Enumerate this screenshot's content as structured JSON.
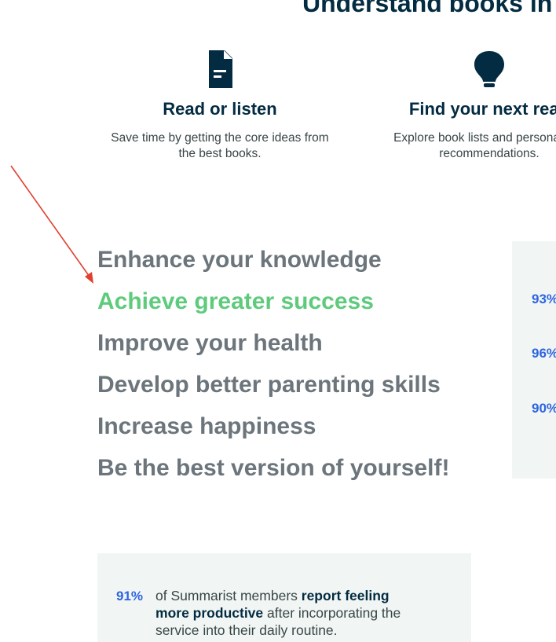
{
  "section_heading": "Understand books in few minutes",
  "features": [
    {
      "icon": "document-icon",
      "title": "Read or listen",
      "description": "Save time by getting the core ideas from the best books."
    },
    {
      "icon": "lightbulb-icon",
      "title": "Find your next read",
      "description": "Explore book lists and personalized recommendations."
    }
  ],
  "headlines": [
    "Enhance your knowledge",
    "Achieve greater success",
    "Improve your health",
    "Develop better parenting skills",
    "Increase happiness",
    "Be the best version of yourself!"
  ],
  "active_headline_index": 1,
  "stats_side": [
    "93%",
    "96%",
    "90%"
  ],
  "bottom_stat": {
    "percent": "91%",
    "text_before": "of Summarist members ",
    "text_bold": "report feeling more productive",
    "text_after": " after incorporating the service into their daily routine."
  },
  "colors": {
    "heading": "#032b41",
    "headline_inactive": "#6b757b",
    "headline_active": "#5ecb7c",
    "stat_blue": "#2d64df",
    "panel_bg": "#f1f6f4",
    "annotation_arrow": "#e0412f"
  }
}
